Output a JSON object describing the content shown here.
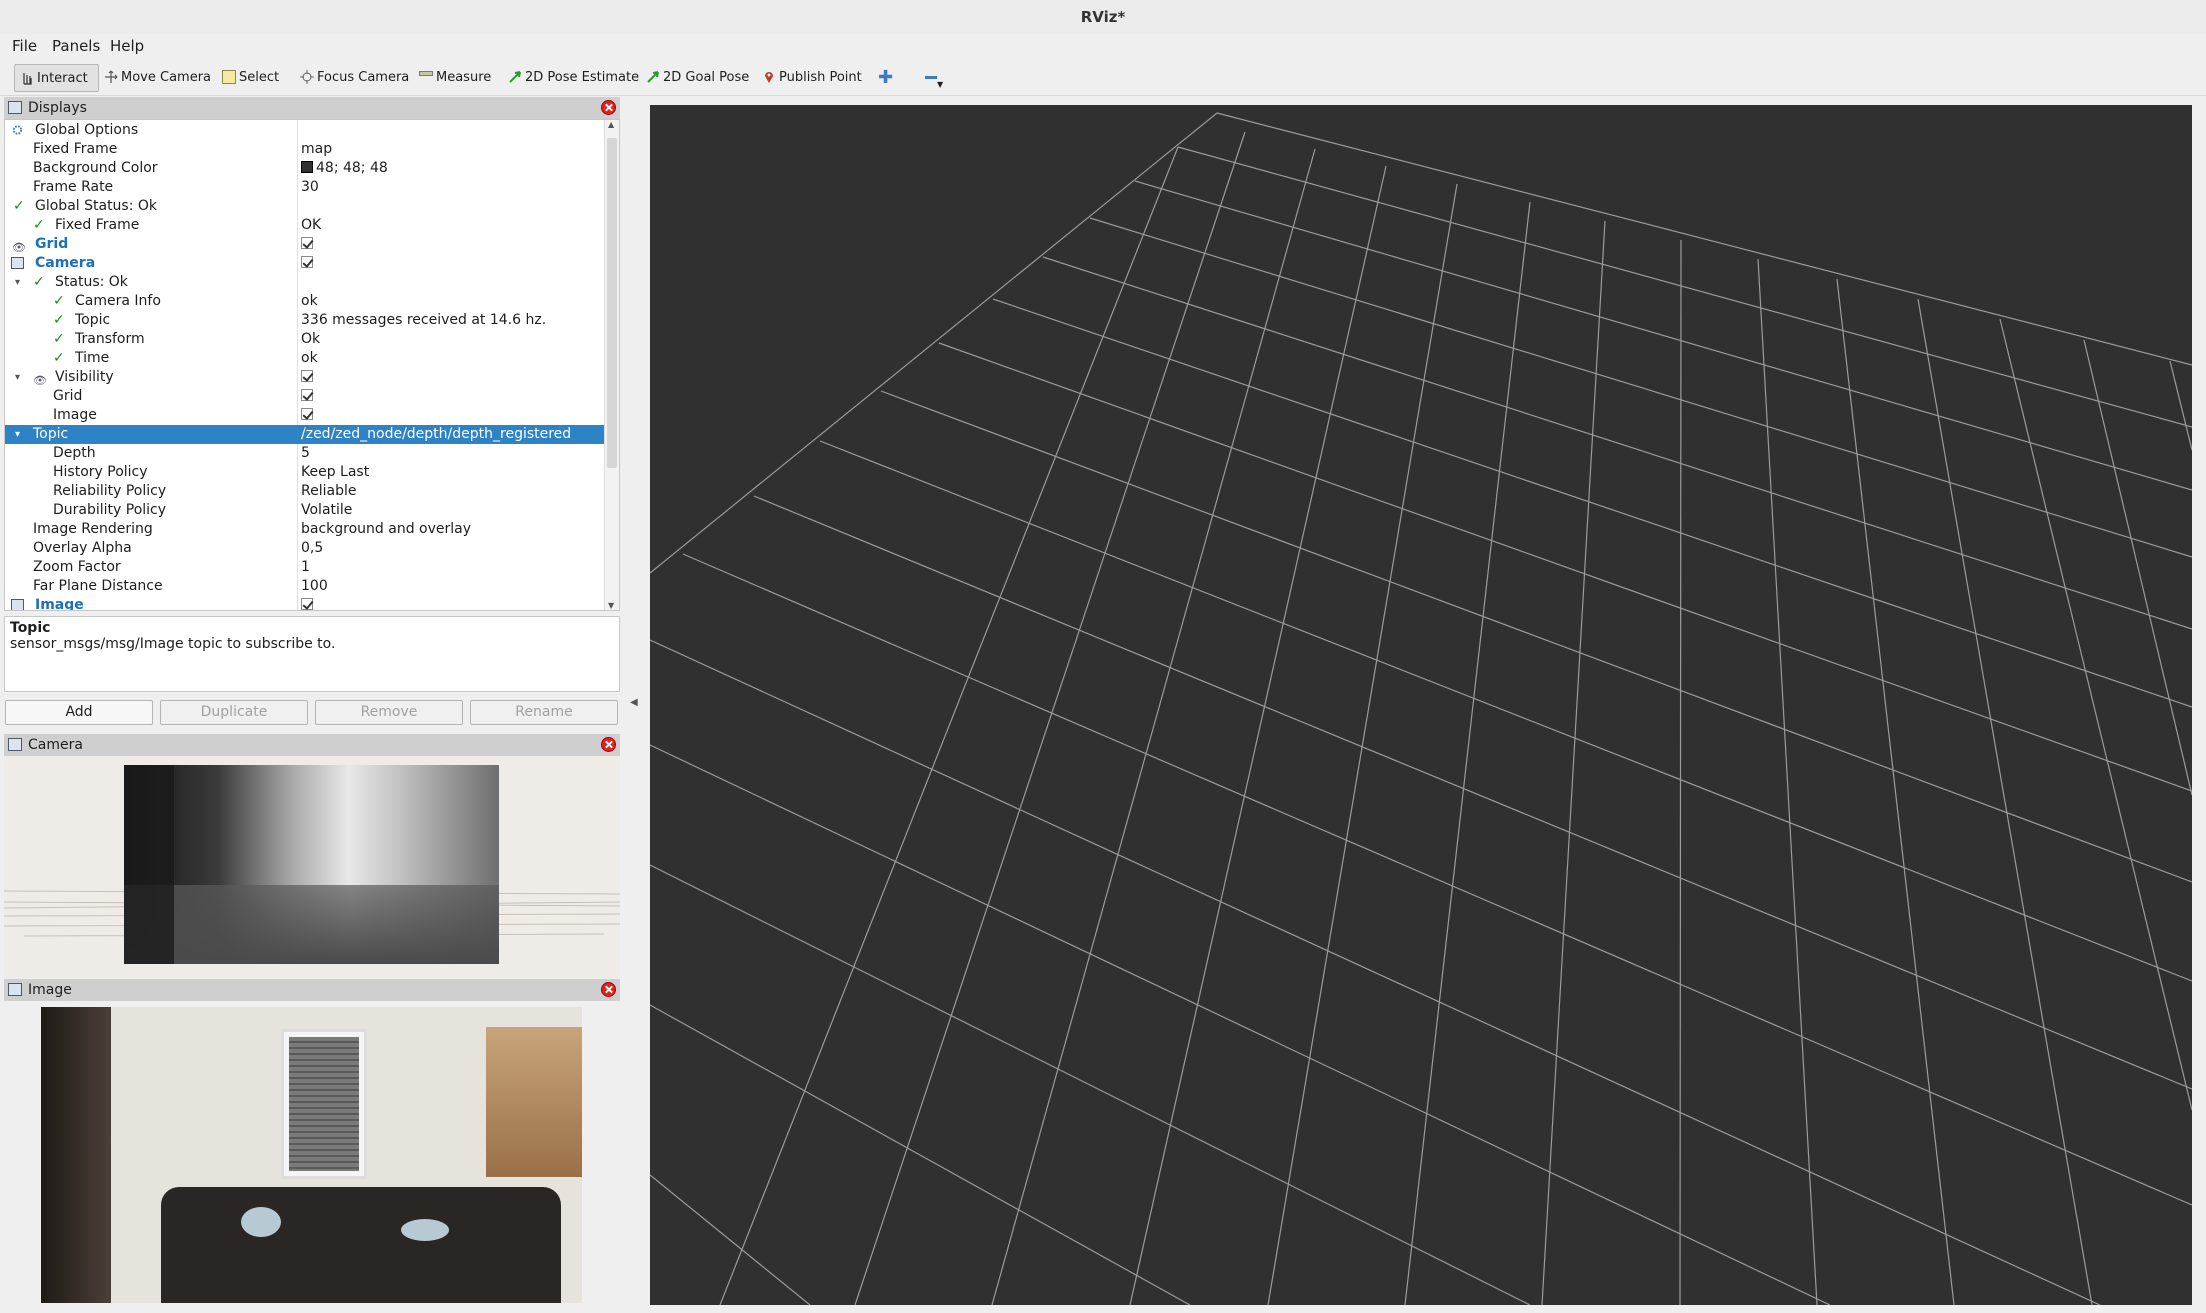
{
  "window": {
    "title": "RViz*"
  },
  "menu": [
    "File",
    "Panels",
    "Help"
  ],
  "toolbar": {
    "interact": "Interact",
    "move_camera": "Move Camera",
    "select": "Select",
    "focus_camera": "Focus Camera",
    "measure": "Measure",
    "pose_estimate": "2D Pose Estimate",
    "goal_pose": "2D Goal Pose",
    "publish_point": "Publish Point"
  },
  "displays": {
    "title": "Displays",
    "rows": [
      {
        "label": "Global Options",
        "value": ""
      },
      {
        "label": "Fixed Frame",
        "value": "map"
      },
      {
        "label": "Background Color",
        "value": "48; 48; 48"
      },
      {
        "label": "Frame Rate",
        "value": "30"
      },
      {
        "label": "Global Status: Ok",
        "value": ""
      },
      {
        "label": "Fixed Frame",
        "value": "OK"
      },
      {
        "label": "Grid",
        "value": ""
      },
      {
        "label": "Camera",
        "value": ""
      },
      {
        "label": "Status: Ok",
        "value": ""
      },
      {
        "label": "Camera Info",
        "value": "ok"
      },
      {
        "label": "Topic",
        "value": "336 messages received at 14.6 hz."
      },
      {
        "label": "Transform",
        "value": "Ok"
      },
      {
        "label": "Time",
        "value": "ok"
      },
      {
        "label": "Visibility",
        "value": ""
      },
      {
        "label": "Grid",
        "value": ""
      },
      {
        "label": "Image",
        "value": ""
      },
      {
        "label": "Topic",
        "value": "/zed/zed_node/depth/depth_registered"
      },
      {
        "label": "Depth",
        "value": "5"
      },
      {
        "label": "History Policy",
        "value": "Keep Last"
      },
      {
        "label": "Reliability Policy",
        "value": "Reliable"
      },
      {
        "label": "Durability Policy",
        "value": "Volatile"
      },
      {
        "label": "Image Rendering",
        "value": "background and overlay"
      },
      {
        "label": "Overlay Alpha",
        "value": "0,5"
      },
      {
        "label": "Zoom Factor",
        "value": "1"
      },
      {
        "label": "Far Plane Distance",
        "value": "100"
      },
      {
        "label": "Image",
        "value": ""
      }
    ],
    "background_color": "#303030"
  },
  "description": {
    "title": "Topic",
    "text": "sensor_msgs/msg/Image topic to subscribe to."
  },
  "buttons": {
    "add": "Add",
    "duplicate": "Duplicate",
    "remove": "Remove",
    "rename": "Rename"
  },
  "camera_panel": {
    "title": "Camera"
  },
  "image_panel": {
    "title": "Image"
  },
  "colors": {
    "selection": "#2e83c6",
    "link_blue": "#1d6fb8",
    "ok_green": "#1a8a1a",
    "viewport": "#303030",
    "grid": "#a0a0a0"
  }
}
